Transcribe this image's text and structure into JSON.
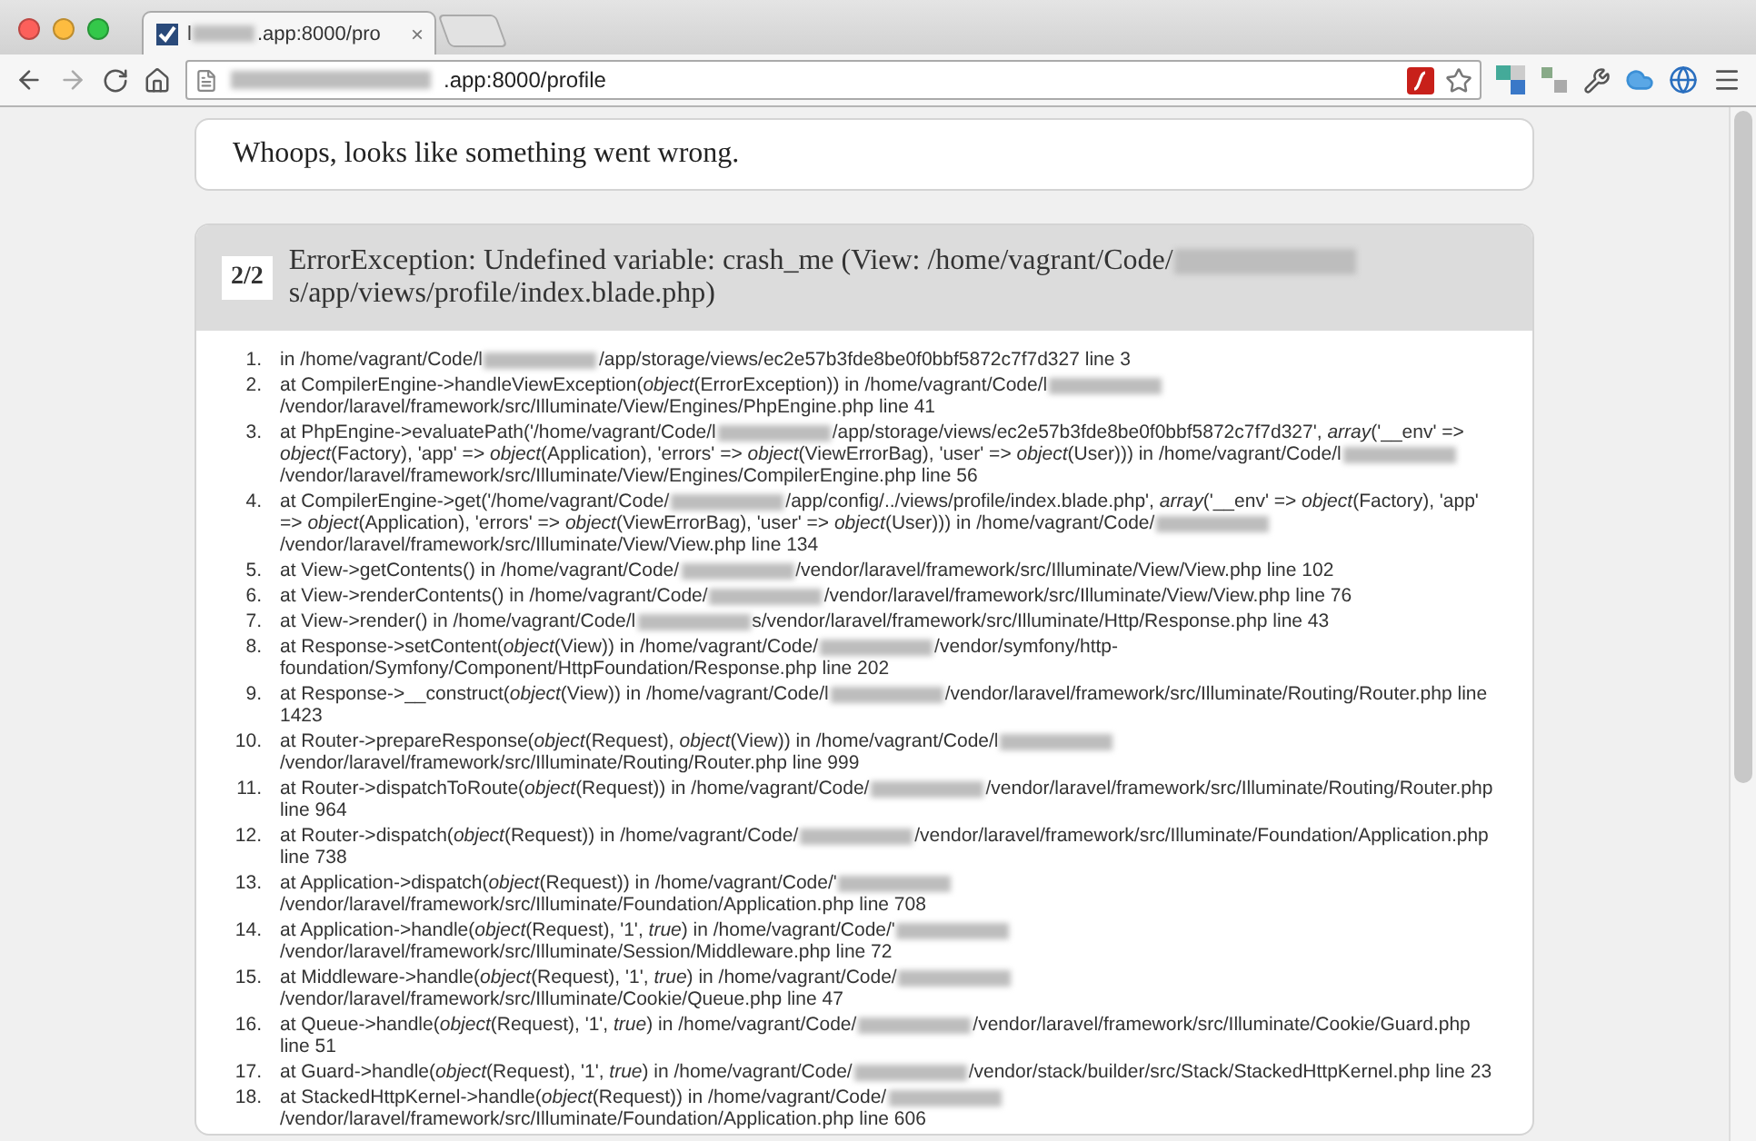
{
  "browser": {
    "tabs": [
      {
        "title_parts": [
          "l",
          ".app:8000/pro"
        ],
        "selected": true,
        "close": "×"
      }
    ],
    "address_bar": {
      "url_after_blur": ".app:8000/profile"
    }
  },
  "page": {
    "whoops": "Whoops, looks like something went wrong.",
    "exception": {
      "counter": "2/2",
      "message_parts": [
        "ErrorException: Undefined variable: crash_me (View: /home/vagrant/Code/",
        "s/app/views/profile/index.blade.php)"
      ],
      "frames": [
        {
          "number": "1.",
          "parts": [
            "in /home/vagrant/Code/l",
            "/app/storage/views/ec2e57b3fde8be0f0bbf5872c7f7d327 line 3"
          ]
        },
        {
          "number": "2.",
          "parts": [
            "at CompilerEngine->handleViewException(*object*(ErrorException)) in /home/vagrant/Code/l",
            "/vendor/laravel/framework/src/Illuminate/View/Engines/PhpEngine.php line 41"
          ]
        },
        {
          "number": "3.",
          "parts": [
            "at PhpEngine->evaluatePath('/home/vagrant/Code/l",
            "/app/storage/views/ec2e57b3fde8be0f0bbf5872c7f7d327', *array*('__env' => *object*(Factory), 'app' => *object*(Application), 'errors' => *object*(ViewErrorBag), 'user' => *object*(User))) in /home/vagrant/Code/l",
            "/vendor/laravel/framework/src/Illuminate/View/Engines/CompilerEngine.php line 56"
          ]
        },
        {
          "number": "4.",
          "parts": [
            "at CompilerEngine->get('/home/vagrant/Code/",
            "/app/config/../views/profile/index.blade.php', *array*('__env' => *object*(Factory), 'app' => *object*(Application), 'errors' => *object*(ViewErrorBag), 'user' => *object*(User))) in /home/vagrant/Code/",
            "/vendor/laravel/framework/src/Illuminate/View/View.php line 134"
          ]
        },
        {
          "number": "5.",
          "parts": [
            "at View->getContents() in /home/vagrant/Code/",
            "/vendor/laravel/framework/src/Illuminate/View/View.php line 102"
          ]
        },
        {
          "number": "6.",
          "parts": [
            "at View->renderContents() in /home/vagrant/Code/",
            "/vendor/laravel/framework/src/Illuminate/View/View.php line 76"
          ]
        },
        {
          "number": "7.",
          "parts": [
            "at View->render() in /home/vagrant/Code/l",
            "s/vendor/laravel/framework/src/Illuminate/Http/Response.php line 43"
          ]
        },
        {
          "number": "8.",
          "parts": [
            "at Response->setContent(*object*(View)) in /home/vagrant/Code/",
            "/vendor/symfony/http-foundation/Symfony/Component/HttpFoundation/Response.php line 202"
          ]
        },
        {
          "number": "9.",
          "parts": [
            "at Response->__construct(*object*(View)) in /home/vagrant/Code/l",
            "/vendor/laravel/framework/src/Illuminate/Routing/Router.php line 1423"
          ]
        },
        {
          "number": "10.",
          "parts": [
            "at Router->prepareResponse(*object*(Request), *object*(View)) in /home/vagrant/Code/l",
            "/vendor/laravel/framework/src/Illuminate/Routing/Router.php line 999"
          ]
        },
        {
          "number": "11.",
          "parts": [
            "at Router->dispatchToRoute(*object*(Request)) in /home/vagrant/Code/",
            "/vendor/laravel/framework/src/Illuminate/Routing/Router.php line 964"
          ]
        },
        {
          "number": "12.",
          "parts": [
            "at Router->dispatch(*object*(Request)) in /home/vagrant/Code/",
            "/vendor/laravel/framework/src/Illuminate/Foundation/Application.php line 738"
          ]
        },
        {
          "number": "13.",
          "parts": [
            "at Application->dispatch(*object*(Request)) in /home/vagrant/Code/'",
            "/vendor/laravel/framework/src/Illuminate/Foundation/Application.php line 708"
          ]
        },
        {
          "number": "14.",
          "parts": [
            "at Application->handle(*object*(Request), '1', *true*) in /home/vagrant/Code/'",
            "/vendor/laravel/framework/src/Illuminate/Session/Middleware.php line 72"
          ]
        },
        {
          "number": "15.",
          "parts": [
            "at Middleware->handle(*object*(Request), '1', *true*) in /home/vagrant/Code/",
            "/vendor/laravel/framework/src/Illuminate/Cookie/Queue.php line 47"
          ]
        },
        {
          "number": "16.",
          "parts": [
            "at Queue->handle(*object*(Request), '1', *true*) in /home/vagrant/Code/",
            "/vendor/laravel/framework/src/Illuminate/Cookie/Guard.php line 51"
          ]
        },
        {
          "number": "17.",
          "parts": [
            "at Guard->handle(*object*(Request), '1', *true*) in /home/vagrant/Code/",
            "/vendor/stack/builder/src/Stack/StackedHttpKernel.php line 23"
          ]
        },
        {
          "number": "18.",
          "parts": [
            "at StackedHttpKernel->handle(*object*(Request)) in /home/vagrant/Code/",
            "/vendor/laravel/framework/src/Illuminate/Foundation/Application.php line 606"
          ]
        }
      ]
    }
  }
}
